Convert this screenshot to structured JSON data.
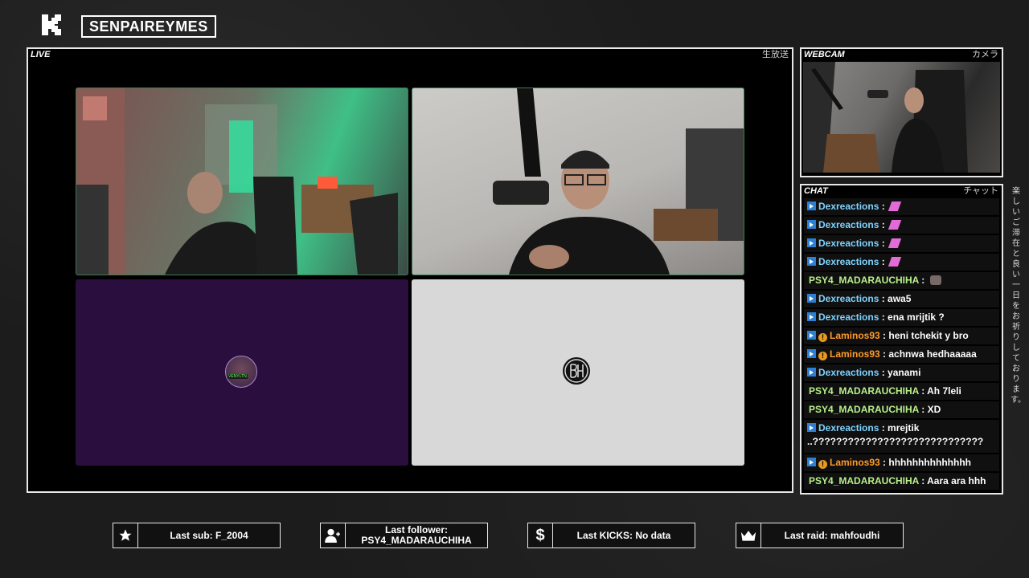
{
  "header": {
    "channel_name": "SENPAIREYMES"
  },
  "live_panel": {
    "label": "LIVE",
    "label_jp": "生放送"
  },
  "stage": {
    "tile3_avatar_tag": "VENYLTN"
  },
  "webcam_panel": {
    "label": "WEBCAM",
    "label_jp": "カメラ"
  },
  "chat_panel": {
    "label": "CHAT",
    "label_jp": "チャット"
  },
  "chat": {
    "messages": [
      {
        "user": "Dexreactions",
        "text": "",
        "emote": "pink"
      },
      {
        "user": "Dexreactions",
        "text": "",
        "emote": "pink"
      },
      {
        "user": "Dexreactions",
        "text": "",
        "emote": "pink"
      },
      {
        "user": "Dexreactions",
        "text": "",
        "emote": "pink"
      },
      {
        "user": "PSY4_MADARAUCHIHA",
        "text": "",
        "emote": "grey"
      },
      {
        "user": "Dexreactions",
        "text": "awa5"
      },
      {
        "user": "Dexreactions",
        "text": "ena mrijtik ?"
      },
      {
        "user": "Laminos93",
        "text": "heni tchekit y bro"
      },
      {
        "user": "Laminos93",
        "text": "achnwa hedhaaaaa"
      },
      {
        "user": "Dexreactions",
        "text": "yanami"
      },
      {
        "user": "PSY4_MADARAUCHIHA",
        "text": "Ah 7leli"
      },
      {
        "user": "PSY4_MADARAUCHIHA",
        "text": "XD"
      },
      {
        "user": "Dexreactions",
        "text": "mrejtik",
        "continuation": "..?????????????????????????????"
      },
      {
        "user": "Laminos93",
        "text": "hhhhhhhhhhhhhh"
      },
      {
        "user": "PSY4_MADARAUCHIHA",
        "text": "Aara ara hhh"
      }
    ],
    "separator": " : "
  },
  "side_text": "楽しいご滞在と良い一日をお祈りしております。",
  "bottom_bar": {
    "last_sub": "Last sub: F_2004",
    "last_follower_label": "Last follower:",
    "last_follower_value": "PSY4_MADARAUCHIHA",
    "last_kicks": "Last KICKS: No data",
    "last_raid": "Last raid: mahfoudhi"
  },
  "icons": {
    "star": "star-icon",
    "follower": "user-plus-icon",
    "kicks": "dollar-icon",
    "raid": "crown-icon"
  },
  "colors": {
    "kick_badge": "#2d7fd3",
    "sub_badge": "#e89a1f",
    "user_blue": "#7fd3ff",
    "user_green": "#b9f08a",
    "user_orange": "#ff9a2a",
    "tile3_bg": "#2a0f3e",
    "tile4_bg": "#d8d8d8"
  }
}
